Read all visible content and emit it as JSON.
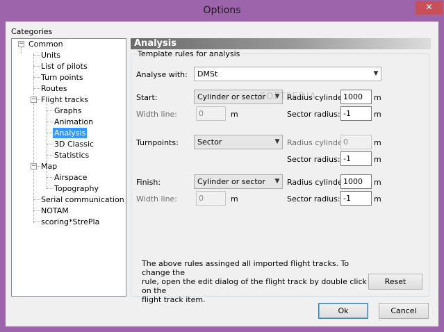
{
  "window": {
    "title": "Options",
    "close_glyph": "✕"
  },
  "categories": {
    "label": "Categories",
    "tree": [
      {
        "label": "Common",
        "expander": "−"
      },
      {
        "label": "Units"
      },
      {
        "label": "List of pilots"
      },
      {
        "label": "Turn points"
      },
      {
        "label": "Routes"
      },
      {
        "label": "Flight tracks",
        "expander": "−"
      },
      {
        "label": "Graphs"
      },
      {
        "label": "Animation"
      },
      {
        "label": "Analysis",
        "selected": true
      },
      {
        "label": "3D Classic"
      },
      {
        "label": "Statistics"
      },
      {
        "label": "Map",
        "expander": "−"
      },
      {
        "label": "Airspace"
      },
      {
        "label": "Topography"
      },
      {
        "label": "Serial communication"
      },
      {
        "label": "NOTAM"
      },
      {
        "label": "scoring*StrePla"
      }
    ]
  },
  "panel": {
    "header": "Analysis",
    "group_caption": "Template rules for analysis",
    "analyse_with": {
      "label": "Analyse with:",
      "value": "DMSt"
    },
    "start": {
      "label": "Start:",
      "value": "Cylinder or sector",
      "radius_cylinder_label": "Radius cylinder:",
      "radius_cylinder": "1000",
      "radius_cylinder_unit": "m",
      "width_line_label": "Width line:",
      "width_line": "0",
      "width_line_unit": "m",
      "sector_radius_label": "Sector radius:",
      "sector_radius": "-1",
      "sector_radius_unit": "m"
    },
    "turnpoints": {
      "label": "Turnpoints:",
      "value": "Sector",
      "radius_cylinder_label": "Radius cylinder:",
      "radius_cylinder": "0",
      "radius_cylinder_unit": "m",
      "sector_radius_label": "Sector radius:",
      "sector_radius": "-1",
      "sector_radius_unit": "m"
    },
    "finish": {
      "label": "Finish:",
      "value": "Cylinder or sector",
      "radius_cylinder_label": "Radius cylinder:",
      "radius_cylinder": "1000",
      "radius_cylinder_unit": "m",
      "width_line_label": "Width line:",
      "width_line": "0",
      "width_line_unit": "m",
      "sector_radius_label": "Sector radius:",
      "sector_radius": "-1",
      "sector_radius_unit": "m"
    },
    "note_lines": [
      "The above rules assinged all imported flight tracks. To change the",
      "rule, open the edit dialog of the flight track by double click on the",
      "flight track item."
    ],
    "reset_label": "Reset"
  },
  "footer": {
    "ok_label": "Ok",
    "cancel_label": "Cancel"
  },
  "colors": {
    "frame": "#9b64ab",
    "close": "#c7505a",
    "selection": "#3399ff"
  }
}
